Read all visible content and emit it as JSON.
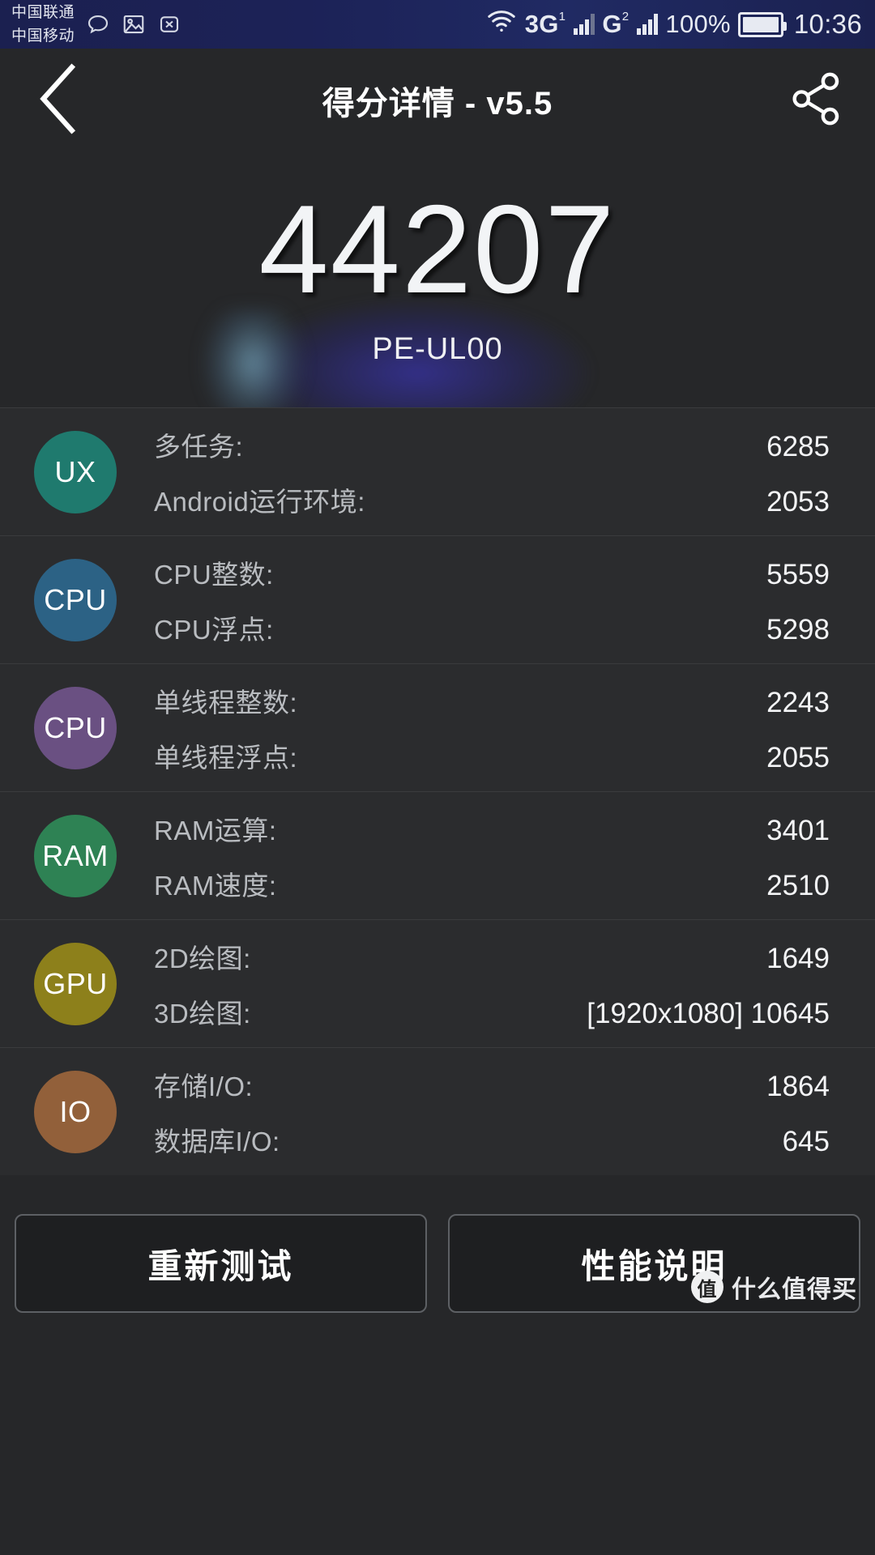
{
  "statusbar": {
    "carrier_line1": "中国联通",
    "carrier_line2": "中国移动",
    "icons": [
      "message-bubble-icon",
      "image-icon",
      "watch-x-icon",
      "wifi-icon"
    ],
    "sim1_label": "3G",
    "sim1_sup": "1",
    "sim2_label": "G",
    "sim2_sup": "2",
    "battery_percent": "100%",
    "time": "10:36"
  },
  "header": {
    "title": "得分详情 - v5.5",
    "back_icon": "back-chevron-icon",
    "share_icon": "share-icon"
  },
  "score": {
    "total": "44207",
    "device_model": "PE-UL00"
  },
  "results": [
    {
      "badge": "UX",
      "color": "#1f7a6e",
      "metrics": [
        {
          "label": "多任务:",
          "value": "6285"
        },
        {
          "label": "Android运行环境:",
          "value": "2053"
        }
      ]
    },
    {
      "badge": "CPU",
      "color": "#2c6285",
      "metrics": [
        {
          "label": "CPU整数:",
          "value": "5559"
        },
        {
          "label": "CPU浮点:",
          "value": "5298"
        }
      ]
    },
    {
      "badge": "CPU",
      "color": "#6a5082",
      "metrics": [
        {
          "label": "单线程整数:",
          "value": "2243"
        },
        {
          "label": "单线程浮点:",
          "value": "2055"
        }
      ]
    },
    {
      "badge": "RAM",
      "color": "#2e8254",
      "metrics": [
        {
          "label": "RAM运算:",
          "value": "3401"
        },
        {
          "label": "RAM速度:",
          "value": "2510"
        }
      ]
    },
    {
      "badge": "GPU",
      "color": "#8d801b",
      "metrics": [
        {
          "label": "2D绘图:",
          "value": "1649"
        },
        {
          "label": "3D绘图:",
          "value": "[1920x1080] 10645"
        }
      ]
    },
    {
      "badge": "IO",
      "color": "#92603a",
      "metrics": [
        {
          "label": "存储I/O:",
          "value": "1864"
        },
        {
          "label": "数据库I/O:",
          "value": "645"
        }
      ]
    }
  ],
  "footer": {
    "retest_label": "重新测试",
    "performance_label": "性能说明",
    "watermark_logo": "值",
    "watermark_text": "什么值得买"
  }
}
